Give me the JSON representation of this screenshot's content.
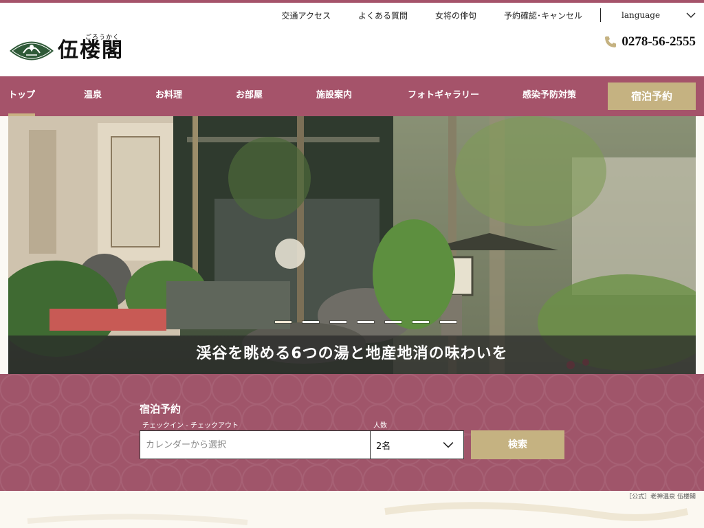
{
  "header": {
    "logo_text": "伍楼閣",
    "logo_ruby": "ごろうかく",
    "utility_links": [
      "交通アクセス",
      "よくある質問",
      "女将の俳句",
      "予約確認･キャンセル"
    ],
    "language_label": "language",
    "phone": "0278-56-2555"
  },
  "nav": {
    "items": [
      "トップ",
      "温泉",
      "お料理",
      "お部屋",
      "施設案内",
      "フォトギャラリー",
      "感染予防対策"
    ],
    "active_index": 0,
    "reserve_label": "宿泊予約"
  },
  "hero": {
    "caption": "渓谷を眺める6つの湯と地産地消の味わいを",
    "slide_count": 7,
    "active_slide": 0
  },
  "booking": {
    "title": "宿泊予約",
    "date_label": "チェックイン - チェックアウト",
    "date_placeholder": "カレンダーから選択",
    "guests_label": "人数",
    "guests_value": "2名",
    "search_label": "検索"
  },
  "footer": {
    "credit": "［公式］老神温泉 伍楼閣"
  },
  "colors": {
    "brand": "#a5536a",
    "gold": "#c5b281",
    "white": "#ffffff"
  },
  "icons": {
    "phone": "phone-icon",
    "chevron": "chevron-down-icon",
    "logo_mark": "fan-logo-icon"
  }
}
